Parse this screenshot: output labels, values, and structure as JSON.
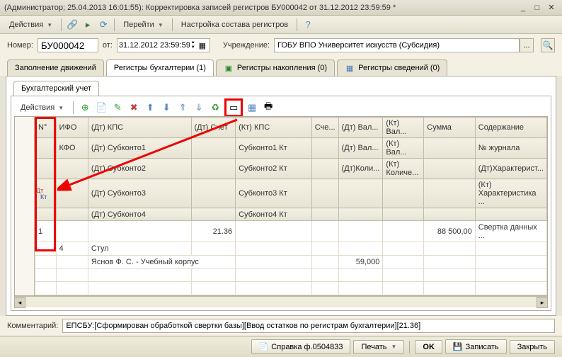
{
  "title": "(Администратор; 25.04.2013 16:01:55): Корректировка записей регистров БУ000042 от 31.12.2012 23:59:59 *",
  "toolbar": {
    "actions": "Действия",
    "go": "Перейти",
    "registers_setup": "Настройка состава регистров"
  },
  "form": {
    "number_label": "Номер:",
    "number": "БУ000042",
    "from_label": "от:",
    "date": "31.12.2012 23:59:59",
    "institution_label": "Учреждение:",
    "institution": "ГОБУ ВПО Университет искусств (Субсидия)"
  },
  "tabs": {
    "fill": "Заполнение движений",
    "accounting": "Регистры бухгалтерии (1)",
    "accumulation": "Регистры накопления (0)",
    "info": "Регистры сведений (0)"
  },
  "subtab": "Бухгалтерский учет",
  "grid_toolbar": {
    "actions": "Действия"
  },
  "headers": {
    "row1": [
      "N°",
      "ИФО",
      "(Дт) КПС",
      "(Дт) Счет",
      "(Кт) КПС",
      "Сче...",
      "(Дт) Вал...",
      "(Кт) Вал...",
      "Сумма",
      "Содержание"
    ],
    "row2": [
      "",
      "КФО",
      "(Дт) Субконто1",
      "",
      "Субконто1 Кт",
      "",
      "(Дт) Вал...",
      "(Кт) Вал...",
      "",
      "№ журнала"
    ],
    "row3": [
      "",
      "",
      "(Дт) Субконто2",
      "",
      "Субконто2 Кт",
      "",
      "(Дт)Коли...",
      "(Кт) Количе...",
      "",
      "(Дт)Характерист..."
    ],
    "row4": [
      "",
      "",
      "(Дт) Субконто3",
      "",
      "Субконто3 Кт",
      "",
      "",
      "",
      "",
      "(Кт) Характеристика ..."
    ],
    "row5": [
      "",
      "",
      "(Дт) Субконто4",
      "",
      "Субконто4 Кт",
      "",
      "",
      "",
      "",
      ""
    ]
  },
  "row": {
    "n": "1",
    "kfo": "4",
    "dt_account": "21.36",
    "sum": "88 500,00",
    "content": "Свертка данных ...",
    "sub1": "Стул",
    "sub2": "Яснов Ф. С. - Учебный корпус",
    "qty": "59,000"
  },
  "dk": {
    "dt": "Дт",
    "kt": "Кт"
  },
  "comment": {
    "label": "Комментарий:",
    "value": "ЕПСБУ:[Сформирован обработкой свертки базы][Ввод остатков по регистрам бухгалтерии][21.36]"
  },
  "footer": {
    "help": "Справка ф.0504833",
    "print": "Печать",
    "ok": "OK",
    "save": "Записать",
    "close": "Закрыть"
  }
}
